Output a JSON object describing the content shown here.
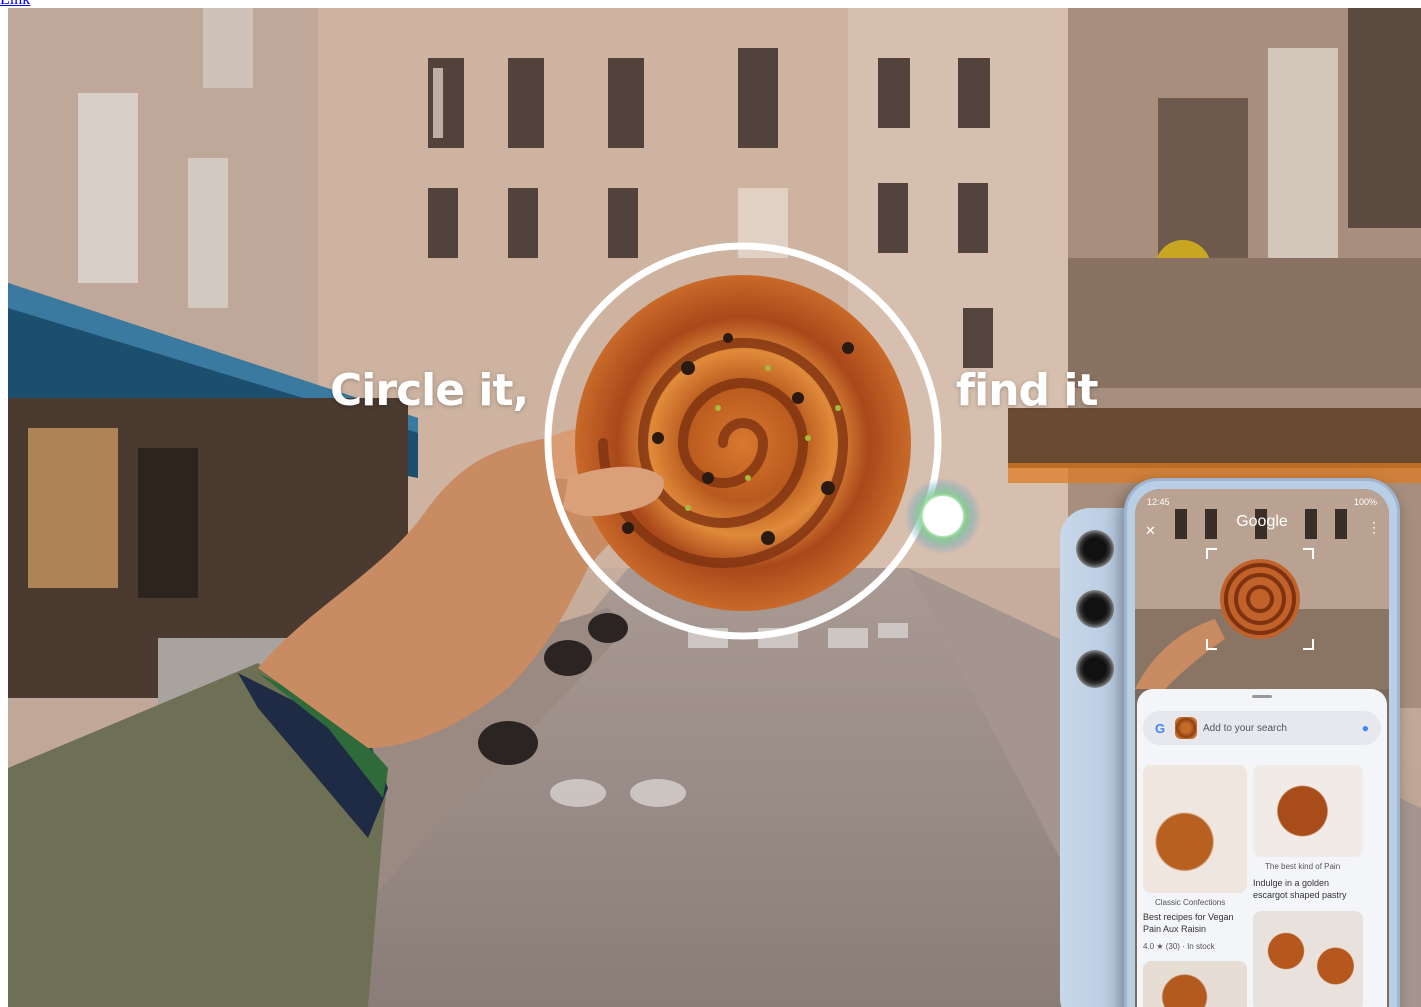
{
  "caption": {
    "text": "",
    "link_label": "Link"
  },
  "headline": {
    "left": "Circle it,",
    "right": "find it"
  },
  "phone": {
    "time": "12:45",
    "battery": "100%",
    "app_title": "Google",
    "search_placeholder": "Add to your search",
    "results": [
      {
        "source": "Classic Confections",
        "title": "Best recipes for Vegan Pain Aux Raisin",
        "meta": "4.0 ★ (30) · In stock"
      },
      {
        "source": "The best kind of Pain",
        "title": "Indulge in a golden escargot shaped pastry"
      }
    ]
  },
  "icons": [
    "close-icon",
    "more-vert-icon",
    "google-g-icon",
    "mic-icon",
    "camera-lens-icon"
  ]
}
